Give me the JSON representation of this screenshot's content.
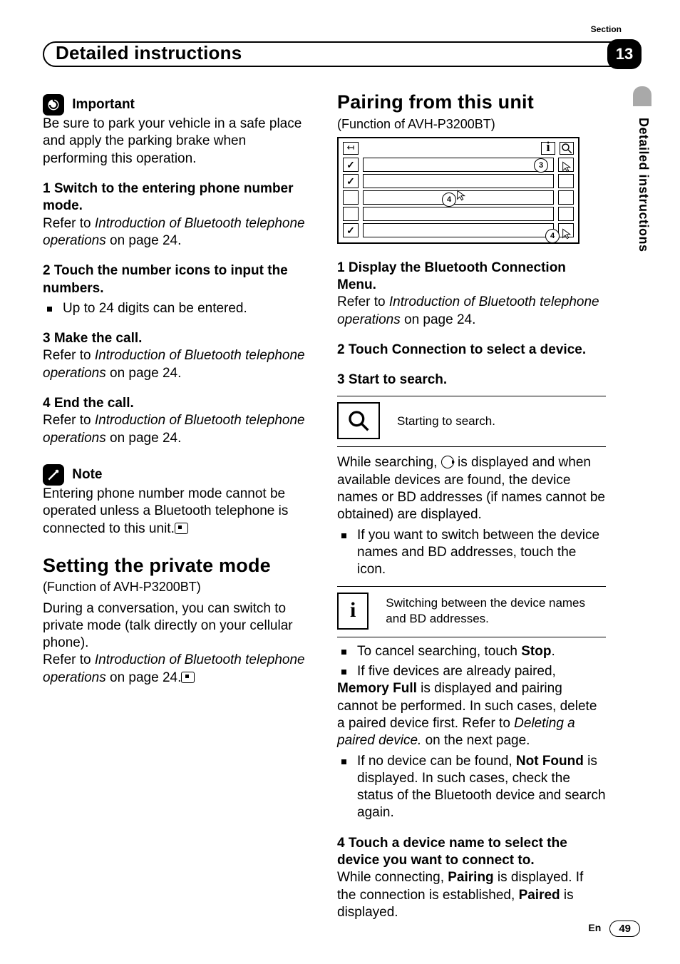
{
  "header": {
    "section_label": "Section",
    "section_number": "13",
    "title": "Detailed instructions",
    "side_tab_text": "Detailed instructions"
  },
  "left": {
    "important_label": "Important",
    "important_body": "Be sure to park your vehicle in a safe place and apply the parking brake when performing this operation.",
    "s1_head": "1    Switch to the entering phone number mode.",
    "s1_body_a": "Refer to ",
    "s1_body_i": "Introduction of Bluetooth telephone operations",
    "s1_body_b": " on page 24.",
    "s2_head": "2    Touch the number icons to input the numbers.",
    "s2_bullet": "Up to 24 digits can be entered.",
    "s3_head": "3    Make the call.",
    "s3_body_a": "Refer to ",
    "s3_body_i": "Introduction of Bluetooth telephone operations",
    "s3_body_b": " on page 24.",
    "s4_head": "4    End the call.",
    "s4_body_a": "Refer to ",
    "s4_body_i": "Introduction of Bluetooth telephone operations",
    "s4_body_b": " on page 24.",
    "note_label": "Note",
    "note_body": "Entering phone number mode cannot be operated unless a Bluetooth telephone is connected to this unit.",
    "h2": "Setting the private mode",
    "sub": "(Function of AVH-P3200BT)",
    "priv_body1": "During a conversation, you can switch to private mode (talk directly on your cellular phone).",
    "priv_body2a": "Refer to ",
    "priv_body2i": "Introduction of Bluetooth telephone operations",
    "priv_body2b": " on page 24."
  },
  "right": {
    "h2": "Pairing from this unit",
    "sub": "(Function of AVH-P3200BT)",
    "circ3": "3",
    "circ4a": "4",
    "circ4b": "4",
    "s1_head": "1    Display the Bluetooth Connection Menu.",
    "s1_body_a": "Refer to ",
    "s1_body_i": "Introduction of Bluetooth telephone operations",
    "s1_body_b": " on page 24.",
    "s2_head": "2    Touch Connection to select a device.",
    "s3_head": "3    Start to search.",
    "search_box_text": "Starting to search.",
    "para1a": "While searching, ",
    "para1b": " is displayed and when available devices are found, the device names or BD addresses (if names cannot be obtained) are displayed.",
    "bullet_switch": "If you want to switch between the device names and BD addresses, touch the icon.",
    "info_box_text": "Switching between the device names and BD addresses.",
    "bullet_cancel_a": "To cancel searching, touch ",
    "bullet_cancel_b": "Stop",
    "bullet_cancel_c": ".",
    "bullet_five": "If five devices are already paired,",
    "memfull_a": "Memory Full",
    "memfull_b": " is displayed and pairing cannot be performed. In such cases, delete a paired device first. Refer to ",
    "memfull_i": "Deleting a paired device.",
    "memfull_c": " on the next page.",
    "bullet_nf_a": "If no device can be found, ",
    "bullet_nf_b": "Not Found",
    "bullet_nf_c": " is displayed. In such cases, check the status of the Bluetooth device and search again.",
    "s4_head": "4    Touch a device name to select the device you want to connect to.",
    "s4_body_a": "While connecting, ",
    "s4_body_b": "Pairing",
    "s4_body_c": " is displayed. If the connection is established, ",
    "s4_body_d": "Paired",
    "s4_body_e": " is displayed."
  },
  "footer": {
    "lang": "En",
    "page": "49"
  }
}
